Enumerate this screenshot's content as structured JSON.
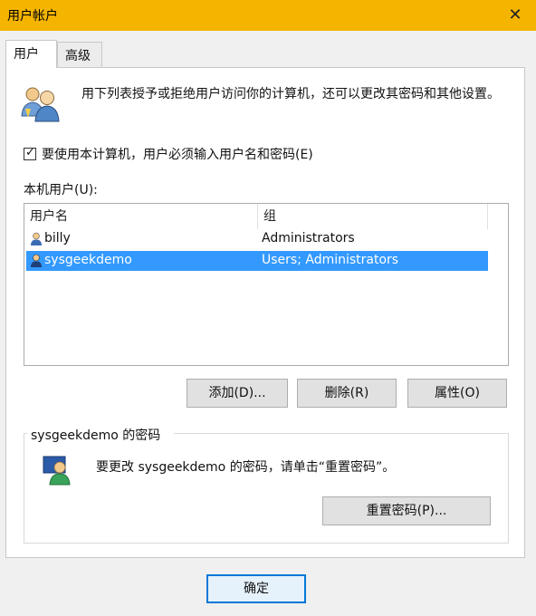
{
  "window": {
    "title": "用户帐户"
  },
  "tabs": [
    {
      "label": "用户"
    },
    {
      "label": "高级"
    }
  ],
  "intro": {
    "text": "用下列表授予或拒绝用户访问你的计算机，还可以更改其密码和其他设置。"
  },
  "require_password": {
    "label": "要使用本计算机，用户必须输入用户名和密码(E)",
    "checked": true
  },
  "local_users": {
    "label": "本机用户(U):",
    "columns": [
      "用户名",
      "组"
    ],
    "rows": [
      {
        "name": "billy",
        "group": "Administrators",
        "selected": false
      },
      {
        "name": "sysgeekdemo",
        "group": "Users; Administrators",
        "selected": true
      }
    ]
  },
  "buttons": {
    "add": "添加(D)...",
    "remove": "删除(R)",
    "properties": "属性(O)"
  },
  "password_section": {
    "title": "sysgeekdemo 的密码",
    "text": "要更改 sysgeekdemo 的密码，请单击“重置密码”。",
    "reset_button": "重置密码(P)..."
  },
  "footer": {
    "ok_button": "确定"
  },
  "colors": {
    "titlebar": "#f4b400",
    "selection": "#3399ff",
    "default_button_border": "#0078d7"
  },
  "icons": {
    "close": "close-icon",
    "users": "users-icon",
    "user": "user-icon"
  }
}
